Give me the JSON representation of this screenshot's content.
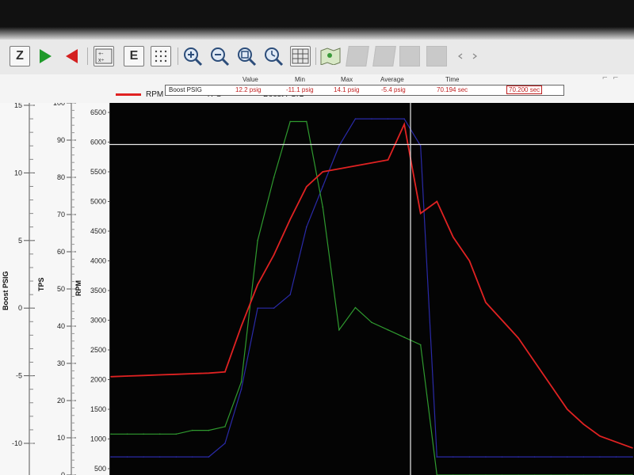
{
  "toolbar": {
    "buttons": [
      {
        "id": "z-button",
        "letter": "Z"
      },
      {
        "id": "play-button"
      },
      {
        "id": "back-button"
      },
      {
        "id": "calc-button"
      },
      {
        "id": "e-button",
        "letter": "E"
      },
      {
        "id": "grid-button"
      },
      {
        "id": "zoom-in-button"
      },
      {
        "id": "zoom-out-button"
      },
      {
        "id": "zoom-fit-button"
      },
      {
        "id": "zoom-time-button"
      },
      {
        "id": "table-button"
      },
      {
        "id": "map-button"
      }
    ]
  },
  "legend": {
    "rpm": {
      "label": "RPM",
      "color": "#e02222"
    },
    "tps": {
      "label": "TPS",
      "color": "#2a8a2a"
    },
    "boost": {
      "label": "Boost PSIG",
      "color": "#1a1a8a"
    }
  },
  "stats": {
    "headers": {
      "value": "Value",
      "min": "Min",
      "max": "Max",
      "average": "Average",
      "time": "Time"
    },
    "channel": "Boost PSIG",
    "value": "12.2 psig",
    "min": "-11.1 psig",
    "max": "14.1 psig",
    "average": "-5.4 psig",
    "time": "70.194 sec",
    "time_selected": "70.200 sec"
  },
  "axes": {
    "boost": {
      "title": "Boost PSIG",
      "ticks": [
        "15",
        "10",
        "5",
        "0",
        "-5",
        "-10"
      ]
    },
    "tps": {
      "title": "TPS",
      "ticks": [
        "100",
        "90",
        "80",
        "70",
        "60",
        "50",
        "40",
        "30",
        "20",
        "10",
        "0"
      ]
    },
    "rpm": {
      "title": "RPM",
      "ticks": [
        "6500",
        "6000",
        "5500",
        "5000",
        "4500",
        "4000",
        "3500",
        "3000",
        "2500",
        "2000",
        "1500",
        "1000",
        "500"
      ]
    }
  },
  "chart_data": {
    "type": "line",
    "xlabel": "",
    "ylabel": "RPM",
    "ylim": [
      500,
      6500
    ],
    "cursor_value_rpm": 5960,
    "series": [
      {
        "name": "RPM",
        "values": [
          2050,
          2060,
          2070,
          2080,
          2090,
          2100,
          2110,
          2130,
          2900,
          3600,
          4100,
          4700,
          5250,
          5500,
          5550,
          5600,
          5650,
          5700,
          6300,
          4800,
          5000,
          4400,
          4000,
          3300,
          3000,
          2700,
          2300,
          1900,
          1500,
          1250,
          1050,
          950,
          850
        ]
      },
      {
        "name": "TPS",
        "values": [
          11,
          11,
          11,
          11,
          11,
          12,
          12,
          13,
          25,
          63,
          80,
          95,
          95,
          72,
          39,
          45,
          41,
          39,
          37,
          35,
          0,
          0,
          0,
          0,
          0,
          0,
          0,
          0,
          0,
          0,
          0,
          0,
          0
        ]
      },
      {
        "name": "Boost PSIG",
        "values": [
          -11,
          -11,
          -11,
          -11,
          -11,
          -11,
          -11,
          -10,
          -6,
          0,
          0,
          1,
          6,
          9,
          12,
          14,
          14,
          14,
          14,
          12,
          -11,
          -11,
          -11,
          -11,
          -11,
          -11,
          -11,
          -11,
          -11,
          -11,
          -11,
          -11,
          -11
        ]
      }
    ]
  }
}
